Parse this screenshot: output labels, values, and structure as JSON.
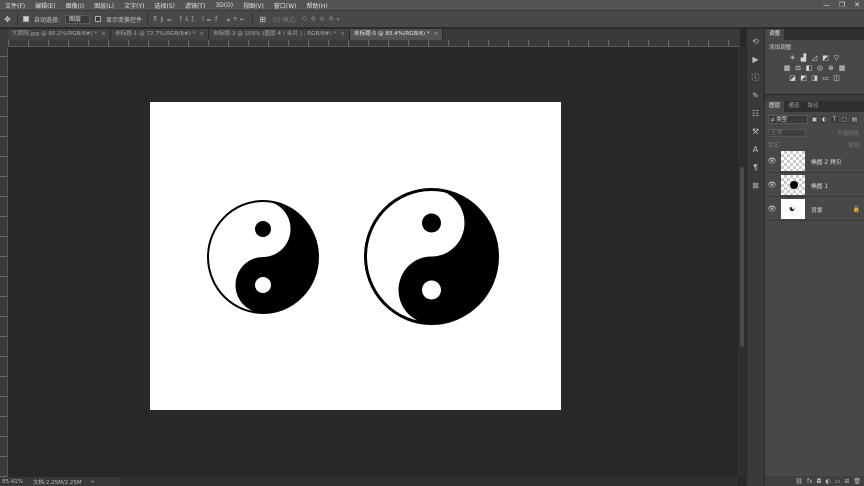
{
  "menu": [
    "文件(F)",
    "编辑(E)",
    "图像(I)",
    "图层(L)",
    "文字(Y)",
    "选择(S)",
    "滤镜(T)",
    "3D(D)",
    "视图(V)",
    "窗口(W)",
    "帮助(H)"
  ],
  "window_controls": {
    "minimize": "—",
    "restore": "❐",
    "close": "✕"
  },
  "options": {
    "auto_select_label": "自动选择:",
    "auto_select_value": "图层",
    "show_transform_label": "显示变换控件",
    "mode_3d_label": "3D 模式:"
  },
  "tabs": [
    {
      "label": "大阴阳.jpg @ 66.2%(RGB/8#) *",
      "active": false
    },
    {
      "label": "未标题-1 @ 72.7%(RGB/8#) *",
      "active": false
    },
    {
      "label": "未标题-3 @ 109% (图层 4 ( 合并 ) , RGB/8#) *",
      "active": false
    },
    {
      "label": "未标题-5 @ 85.4%(RGB/8) *",
      "active": true
    }
  ],
  "status": {
    "zoom": "85.41%",
    "doc": "文档:2.25M/2.25M"
  },
  "panels": {
    "adjust_tabs": [
      "调整"
    ],
    "add_adjustment_label": "添加调整",
    "layer_tabs": [
      "图层",
      "通道",
      "路径"
    ],
    "kind_label": "ρ 类型",
    "blend_mode": "正常",
    "opacity_label": "不透明度:",
    "lock_label": "锁定:",
    "fill_label": "填充:"
  },
  "layers": [
    {
      "name": "椭圆 2 拷贝",
      "visible": true
    },
    {
      "name": "椭圆 1",
      "visible": true
    },
    {
      "name": "背景",
      "visible": true
    }
  ],
  "colors": {
    "menu_bg": "#535353",
    "workspace": "#282828",
    "panel": "#484848",
    "canvas": "#ffffff"
  }
}
